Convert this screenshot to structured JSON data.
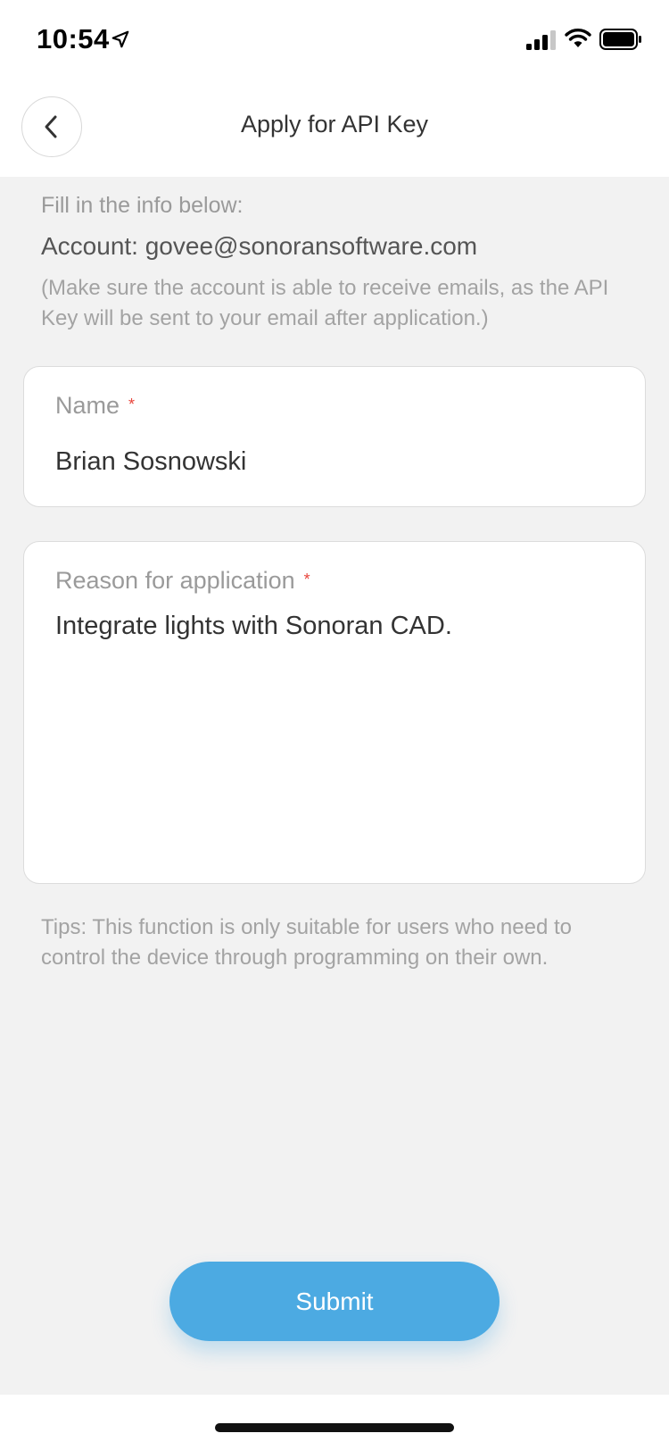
{
  "status_bar": {
    "time": "10:54",
    "icons": [
      "location-arrow-icon",
      "cellular-signal-icon",
      "wifi-icon",
      "battery-icon"
    ]
  },
  "header": {
    "title": "Apply for API Key",
    "back_icon": "chevron-left-icon"
  },
  "intro": {
    "label": "Fill in the info below:",
    "account": "Account: govee@sonoransoftware.com",
    "note": "(Make sure the account is able to receive emails, as the API Key will be sent to your email after application.)"
  },
  "form": {
    "name": {
      "label": "Name",
      "required_mark": "*",
      "value": "Brian Sosnowski"
    },
    "reason": {
      "label": "Reason for application",
      "required_mark": "*",
      "value": "Integrate lights with Sonoran CAD."
    }
  },
  "tips": "Tips: This function is only suitable for users who need to control the device through programming on their own.",
  "submit_label": "Submit",
  "colors": {
    "accent": "#4caae2",
    "required": "#e8453c",
    "background": "#f2f2f2"
  }
}
